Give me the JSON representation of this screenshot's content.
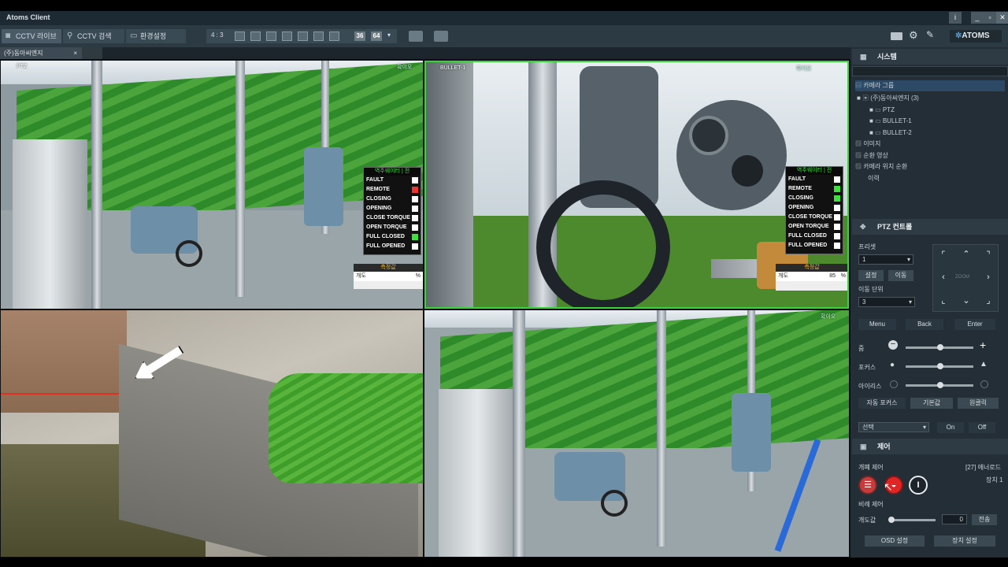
{
  "app": {
    "title": "Atoms Client"
  },
  "window": {
    "info": "i",
    "minimize": "_",
    "maximize": "▫",
    "close": "✕"
  },
  "nav": {
    "live": "CCTV 라이브",
    "search": "CCTV 검색",
    "settings": "환경설정"
  },
  "layout": {
    "ratio": "4 : 3",
    "n36": "36",
    "n64": "64"
  },
  "brand": "ATOMS",
  "tab": {
    "label": "(주)동아씨엔지",
    "close": "×"
  },
  "cams": {
    "c1": {
      "label": "PTZ",
      "corner": "확이오"
    },
    "c2": {
      "label": "BULLET-1",
      "corner": "확이오"
    },
    "c4": {
      "corner": "확이오"
    }
  },
  "status_panel": {
    "header": "역주웨이터 | 전",
    "rows": [
      "FAULT",
      "REMOTE",
      "CLOSING",
      "OPENING",
      "CLOSE TORQUE",
      "OPEN TORQUE",
      "FULL CLOSED",
      "FULL OPENED"
    ],
    "gauge_header": "측정값",
    "gauge_label": "개도",
    "gauge_unit": "%",
    "gauge2_value": "85"
  },
  "system": {
    "title": "시스템",
    "tree": {
      "group": "카메라 그룹",
      "site": "(주)동아씨엔지",
      "site_count": "(3)",
      "cams": [
        "PTZ",
        "BULLET-1",
        "BULLET-2"
      ],
      "image": "이미지",
      "tour": "순환 영상",
      "preset_tour": "카메라 위치 순환",
      "history": "이력"
    }
  },
  "ptz": {
    "title": "PTZ 컨트롤",
    "preset_label": "프리셋",
    "preset_value": "1",
    "set_btn": "설정",
    "move_btn": "이동",
    "unit_label": "이동 단위",
    "unit_value": "3",
    "zoom_center": "ZOOM",
    "menu": "Menu",
    "back": "Back",
    "enter": "Enter",
    "zoom": "줌",
    "focus": "포커스",
    "iris": "아이리스",
    "auto_focus": "자동 포커스",
    "default": "기본값",
    "one_click": "원클릭",
    "select": "선택",
    "on": "On",
    "off": "Off"
  },
  "control": {
    "title": "제어",
    "open_close": "개폐 제어",
    "device_name": "[27] 에너로드",
    "device_num": "장치 1",
    "proportional": "비례 제어",
    "open_label": "개도값",
    "open_value": "0",
    "send": "전송",
    "osd": "OSD 설정",
    "device_setting": "장치 설정"
  }
}
